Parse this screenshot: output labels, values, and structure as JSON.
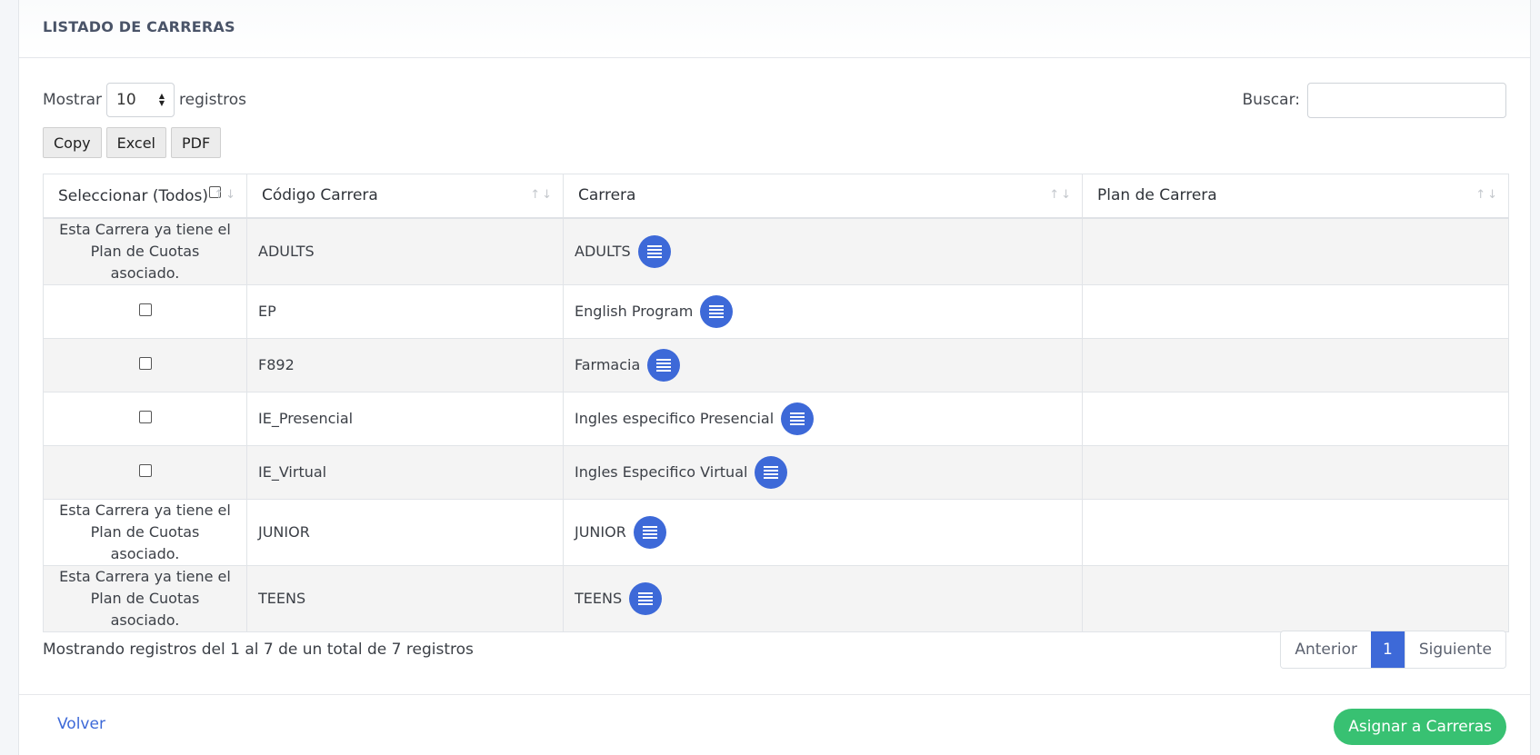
{
  "page": {
    "title": "LISTADO DE CARRERAS"
  },
  "controls": {
    "show_label": "Mostrar",
    "page_size": "10",
    "records_label": "registros",
    "search_label": "Buscar:",
    "search_value": ""
  },
  "export_buttons": {
    "copy": "Copy",
    "excel": "Excel",
    "pdf": "PDF"
  },
  "table": {
    "columns": {
      "select": "Seleccionar (Todos)",
      "code": "Código Carrera",
      "career": "Carrera",
      "plan": "Plan de Carrera"
    },
    "rows": [
      {
        "select_text": "Esta Carrera ya tiene el Plan de Cuotas asociado.",
        "code": "ADULTS",
        "career": "ADULTS",
        "plan": ""
      },
      {
        "select_text": "",
        "code": "EP",
        "career": "English Program",
        "plan": ""
      },
      {
        "select_text": "",
        "code": "F892",
        "career": "Farmacia",
        "plan": ""
      },
      {
        "select_text": "",
        "code": "IE_Presencial",
        "career": "Ingles especifico Presencial",
        "plan": ""
      },
      {
        "select_text": "",
        "code": "IE_Virtual",
        "career": "Ingles Especifico Virtual",
        "plan": ""
      },
      {
        "select_text": "Esta Carrera ya tiene el Plan de Cuotas asociado.",
        "code": "JUNIOR",
        "career": "JUNIOR",
        "plan": ""
      },
      {
        "select_text": "Esta Carrera ya tiene el Plan de Cuotas asociado.",
        "code": "TEENS",
        "career": "TEENS",
        "plan": ""
      }
    ]
  },
  "info": {
    "text": "Mostrando registros del 1 al 7 de un total de 7 registros"
  },
  "pagination": {
    "prev": "Anterior",
    "current": "1",
    "next": "Siguiente"
  },
  "footer": {
    "back": "Volver",
    "assign": "Asignar a Carreras"
  },
  "colors": {
    "primary": "#3d69d8",
    "success": "#38c172",
    "stripe": "#f4f4f4"
  }
}
